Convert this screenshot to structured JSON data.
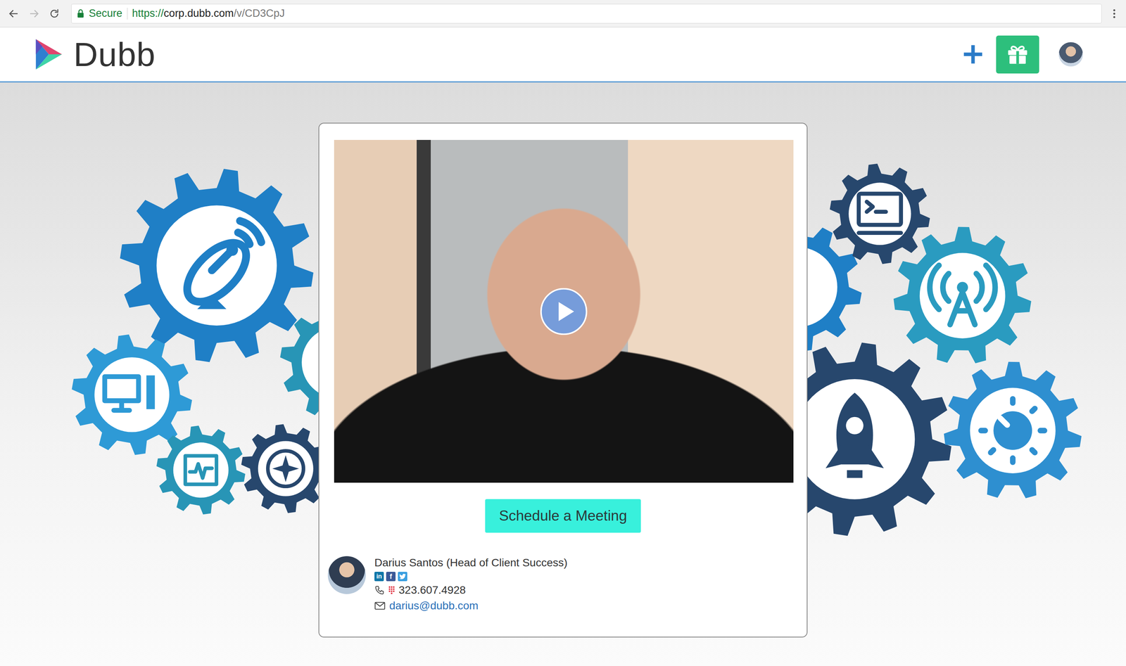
{
  "browser": {
    "secure_label": "Secure",
    "url_scheme": "https://",
    "url_host": "corp.dubb.com",
    "url_path": "/v/CD3CpJ",
    "back_enabled": true,
    "forward_enabled": false
  },
  "header": {
    "logo_text": "Dubb"
  },
  "video": {
    "playing": false
  },
  "cta": {
    "label": "Schedule a Meeting"
  },
  "profile": {
    "name": "Darius Santos (Head of Client Success)",
    "social": [
      {
        "kind": "linkedin",
        "glyph": "in"
      },
      {
        "kind": "facebook",
        "glyph": "f"
      },
      {
        "kind": "twitter"
      }
    ],
    "phone": "323.607.4928",
    "email": "darius@dubb.com"
  }
}
